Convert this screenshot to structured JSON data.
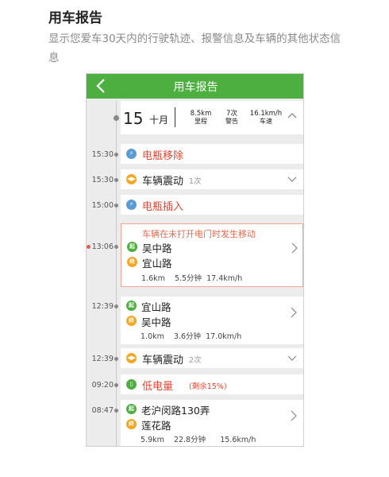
{
  "header": {
    "title": "用车报告",
    "description": "显示您爱车30天内的行驶轨迹、报警信息及车辆的其他状态信息"
  },
  "app": {
    "nav_title": "用车报告",
    "date": {
      "day": "15",
      "month": "十月",
      "stats": [
        {
          "value": "8.5km",
          "label": "里程"
        },
        {
          "value": "7次",
          "label": "警告"
        },
        {
          "value": "16.1km/h",
          "label": "车速"
        }
      ]
    },
    "events": [
      {
        "time": "15:30",
        "title": "电瓶移除"
      },
      {
        "time": "15:30",
        "title": "车辆震动",
        "count": "1次"
      },
      {
        "time": "15:00",
        "title": "电瓶插入"
      },
      {
        "time": "13:06",
        "alert": "车辆在未打开电门时发生移动",
        "from": "吴中路",
        "to": "宜山路",
        "meta": "1.6km    5.5分钟  17.4km/h"
      },
      {
        "time": "12:39",
        "from": "宜山路",
        "to": "吴中路",
        "meta": "1.0km    3.6分钟  17.0km/h"
      },
      {
        "time": "12:39",
        "title": "车辆震动",
        "count": "2次"
      },
      {
        "time": "09:20",
        "title": "低电量",
        "note": "(剩余15%)"
      },
      {
        "time": "08:47",
        "from": "老沪闵路130弄",
        "to": "莲花路",
        "meta": "5.9km    22.8分钟      15.6km/h"
      }
    ],
    "icon_labels": {
      "start": "起",
      "end": "终"
    }
  }
}
